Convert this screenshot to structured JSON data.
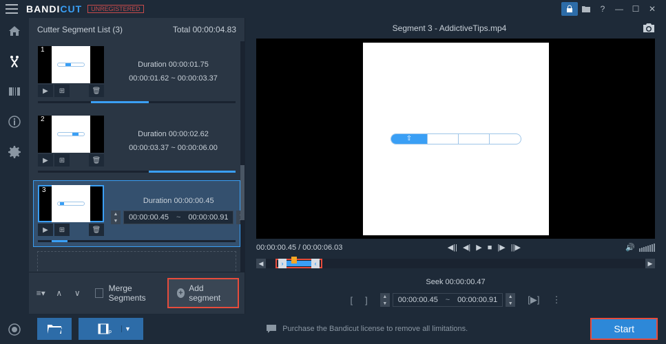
{
  "titlebar": {
    "brand1": "BANDI",
    "brand2": "CUT",
    "unregistered": "UNREGISTERED"
  },
  "seg_panel": {
    "title": "Cutter Segment List (3)",
    "total_label": "Total 00:00:04.83",
    "merge_label": "Merge Segments",
    "add_segment": "Add segment"
  },
  "segments": [
    {
      "num": "1",
      "duration": "Duration 00:00:01.75",
      "range": "00:00:01.62 ~ 00:00:03.37"
    },
    {
      "num": "2",
      "duration": "Duration 00:00:02.62",
      "range": "00:00:03.37 ~ 00:00:06.00"
    },
    {
      "num": "3",
      "duration": "Duration 00:00:00.45",
      "start": "00:00:00.45",
      "end": "00:00:00.91"
    }
  ],
  "preview": {
    "title": "Segment 3 - AddictiveTips.mp4",
    "time": "00:00:00.45 / 00:00:06.03",
    "seek_label": "Seek 00:00:00.47",
    "seek_start": "00:00:00.45",
    "seek_end": "00:00:00.91",
    "seek_sep": "~"
  },
  "footer": {
    "license_msg": "Purchase the Bandicut license to remove all limitations.",
    "start": "Start"
  }
}
